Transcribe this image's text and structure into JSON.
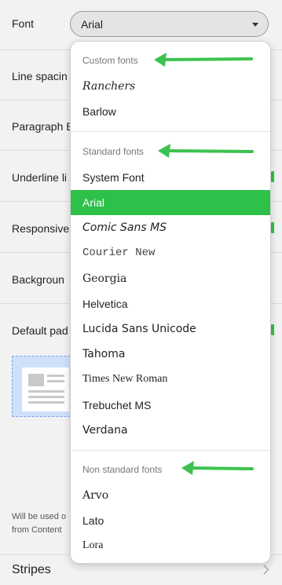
{
  "settings": {
    "font_label": "Font",
    "font_value": "Arial",
    "rows": [
      "Line spacin",
      "Paragraph B",
      "Underline li",
      "Responsive",
      "Backgroun",
      "Default pad"
    ],
    "helper_line1": "Will be used o",
    "helper_line2": "from Content",
    "stripes_label": "Stripes"
  },
  "menu": {
    "custom_label": "Custom fonts",
    "custom": [
      "Ranchers",
      "Barlow"
    ],
    "standard_label": "Standard fonts",
    "standard": [
      "System Font",
      "Arial",
      "Comic Sans MS",
      "Courier New",
      "Georgia",
      "Helvetica",
      "Lucida Sans Unicode",
      "Tahoma",
      "Times New Roman",
      "Trebuchet MS",
      "Verdana"
    ],
    "selected": "Arial",
    "nonstandard_label": "Non standard fonts",
    "nonstandard": [
      "Arvo",
      "Lato",
      "Lora"
    ]
  },
  "colors": {
    "selection": "#2ec14a",
    "annotation_arrow": "#3dc24f",
    "toggle": "#34c245"
  },
  "icons": [
    "caret-down-icon",
    "chevron-right-icon",
    "image-placeholder-icon"
  ]
}
